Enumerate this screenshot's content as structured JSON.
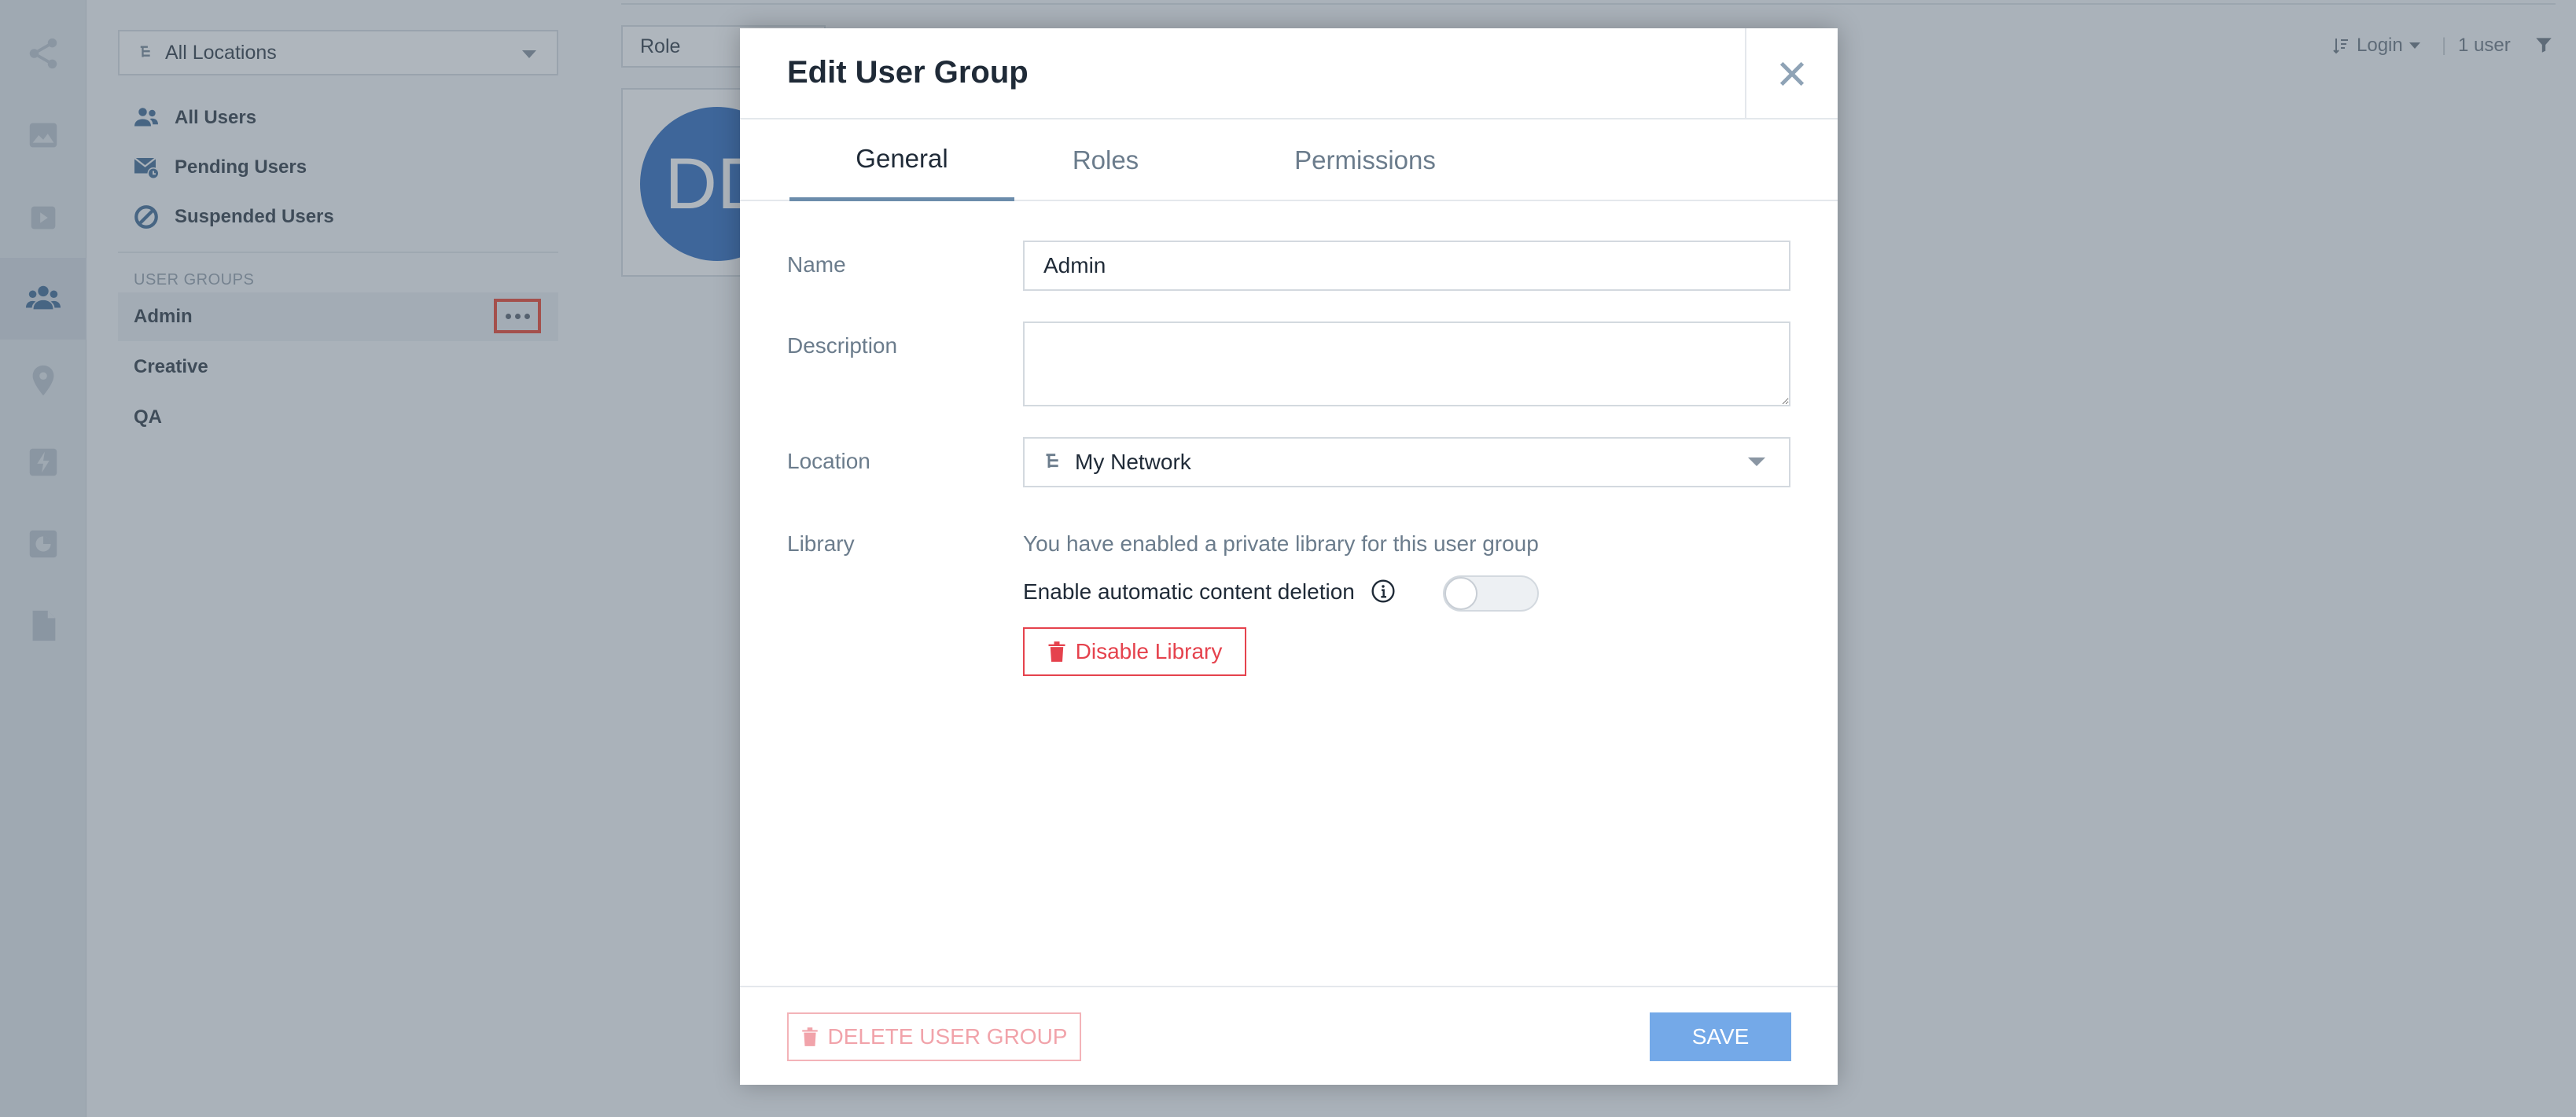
{
  "sidebar": {
    "location_select": "All Locations",
    "nav": [
      {
        "label": "All Users",
        "icon": "users-icon"
      },
      {
        "label": "Pending Users",
        "icon": "pending-users-icon"
      },
      {
        "label": "Suspended Users",
        "icon": "suspended-icon"
      }
    ],
    "groups_header": "USER GROUPS",
    "groups": [
      {
        "label": "Admin",
        "selected": true
      },
      {
        "label": "Creative"
      },
      {
        "label": "QA"
      }
    ]
  },
  "main": {
    "role_filter": "Role",
    "avatar_initials": "DD",
    "sort_label": "Login",
    "user_count": "1 user"
  },
  "modal": {
    "title": "Edit User Group",
    "tabs": [
      "General",
      "Roles",
      "Permissions"
    ],
    "active_tab": "General",
    "fields": {
      "name_label": "Name",
      "name_value": "Admin",
      "description_label": "Description",
      "description_value": "",
      "location_label": "Location",
      "location_value": "My Network",
      "library_label": "Library",
      "library_note": "You have enabled a private library for this user group",
      "auto_delete_label": "Enable automatic content deletion",
      "auto_delete_enabled": false,
      "disable_library_button": "Disable Library"
    },
    "footer": {
      "delete_button": "DELETE USER GROUP",
      "save_button": "SAVE"
    }
  },
  "colors": {
    "accent_blue": "#74a9e8",
    "danger_red": "#e5424d",
    "highlight_box": "#e8321c",
    "avatar_blue": "#1d5fb8"
  }
}
